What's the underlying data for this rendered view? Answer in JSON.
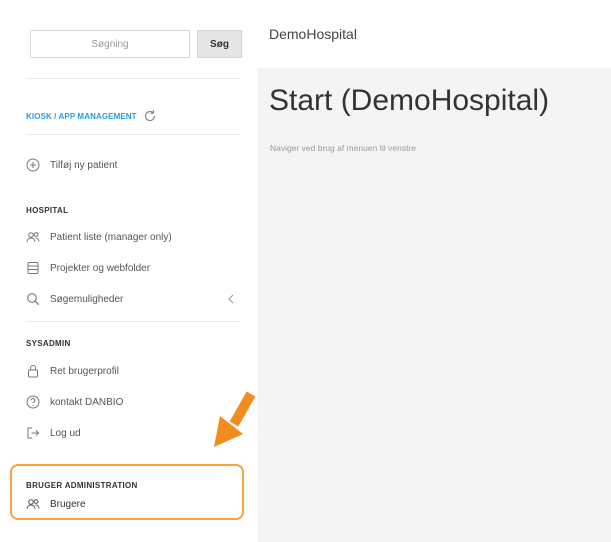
{
  "search": {
    "placeholder": "Søgning",
    "button_label": "Søg"
  },
  "kiosk": {
    "label": "KIOSK / APP MANAGEMENT",
    "icon": "refresh-icon"
  },
  "add_patient": {
    "label": "Tilføj ny patient",
    "icon": "plus-circle-icon"
  },
  "hospital": {
    "heading": "HOSPITAL",
    "items": [
      {
        "label": "Patient liste (manager only)",
        "icon": "users-icon"
      },
      {
        "label": "Projekter og webfolder",
        "icon": "database-icon"
      },
      {
        "label": "Søgemuligheder",
        "icon": "search-icon"
      }
    ]
  },
  "sysadmin": {
    "heading": "SYSADMIN",
    "items": [
      {
        "label": "Ret brugerprofil",
        "icon": "lock-icon"
      },
      {
        "label": "kontakt DANBIO",
        "icon": "help-circle-icon"
      },
      {
        "label": "Log ud",
        "icon": "logout-icon"
      }
    ]
  },
  "user_admin": {
    "heading": "BRUGER ADMINISTRATION",
    "items": [
      {
        "label": "Brugere",
        "icon": "users-icon"
      }
    ]
  },
  "main": {
    "topbar_title": "DemoHospital",
    "page_title": "Start (DemoHospital)",
    "page_subtitle": "Naviger ved brug af menuen til venstre"
  },
  "colors": {
    "accent_blue": "#2d9be0",
    "highlight_orange": "#f5a340",
    "arrow_orange": "#f28c1c"
  }
}
